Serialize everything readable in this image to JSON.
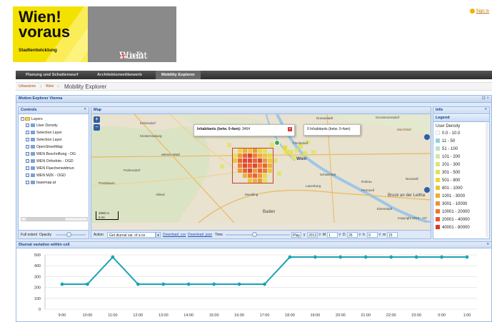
{
  "header": {
    "logo_title": "Wien! voraus",
    "logo_subtitle": "Stadtentwicklung",
    "city_logo": "StaDt",
    "city_logo_cross": "+",
    "city_logo_end": "Wien",
    "signout_label": "Sign in"
  },
  "nav": {
    "tabs": [
      {
        "label": "Planung und Schattenwurf"
      },
      {
        "label": "Architekturwettbewerb"
      },
      {
        "label": "Mobility Explorer"
      }
    ]
  },
  "breadcrumb": {
    "items": [
      "Urbanizmo",
      "Wien"
    ],
    "current": "Mobility Explorer"
  },
  "app": {
    "title": "Motion Explorer Vienna",
    "controls": {
      "title": "Controls",
      "layers_root": "Layers",
      "layers": [
        "User Density",
        "Selection Layer",
        "Selection Layer",
        "OpenStreetMap",
        "WEN Beschriftung - OG",
        "WEN Orthofoto - OGD",
        "WEN Flaechenwidmun",
        "WEN MZK - OGD",
        "basemap.at"
      ],
      "full_extent": "Full extent",
      "opacity": "Opacity"
    },
    "map": {
      "title": "Map",
      "popup1_label": "Inhabitants (betw. 0-4am):",
      "popup1_value": "3464",
      "popup2_text": "0 Inhabitants (betw. 0-4am)",
      "scale_1": "2000 m",
      "scale_2": "5 mi",
      "copyright": "Copyright 2013 - AIT",
      "labels": [
        "Donaustadt",
        "Grossenzersdorf",
        "Marchfeld",
        "Kritzendorf",
        "Klosterneuburg",
        "Floridsdorf",
        "Wiener Wald",
        "Purkersdorf",
        "Wien",
        "Schwechat",
        "Laxenburg",
        "Bruck an der Leitha",
        "Baden",
        "Moedling",
        "Eisenstadt",
        "Neusiedl",
        "Rohrau",
        "Petronell",
        "Alland",
        "Pressbaum"
      ],
      "action_label": "Action",
      "action_value": "Get diurnal var. of a ce",
      "download_csv": "Download .csv",
      "download_json": "Download .json",
      "time_label": "Time",
      "play_label": "Play",
      "y_label": "y",
      "year": "2013",
      "m_label": "M",
      "month": "1",
      "d_label": "D",
      "day": "26",
      "h_label": "h",
      "hour": "9",
      "min_label": "m",
      "minute": "15"
    },
    "info": {
      "title": "Info",
      "legend_title": "Legend",
      "legend_heading": "User Density",
      "legend": [
        {
          "label": "0.0 - 10.0",
          "color": "#ffffff"
        },
        {
          "label": "11 - 50",
          "color": "#8fd3e0"
        },
        {
          "label": "51 - 100",
          "color": "#b7e2c9"
        },
        {
          "label": "101 - 200",
          "color": "#d4e79a"
        },
        {
          "label": "201 - 300",
          "color": "#dfe46e"
        },
        {
          "label": "301 - 500",
          "color": "#e6e14a"
        },
        {
          "label": "501 - 800",
          "color": "#e9d832"
        },
        {
          "label": "801 - 1000",
          "color": "#edc52c"
        },
        {
          "label": "1001 - 3000",
          "color": "#efac2a"
        },
        {
          "label": "3001 - 10000",
          "color": "#f09128"
        },
        {
          "label": "10001 - 20000",
          "color": "#f07426"
        },
        {
          "label": "20001 - 40000",
          "color": "#ec5524"
        },
        {
          "label": "40001 - 80000",
          "color": "#e43522"
        }
      ]
    },
    "chart_panel_title": "Diurnal variation within cell"
  },
  "chart_data": {
    "type": "line",
    "title": "Diurnal variation within cell",
    "categories": [
      "9:00",
      "10:00",
      "11:00",
      "12:00",
      "13:00",
      "14:00",
      "15:00",
      "16:00",
      "17:00",
      "18:00",
      "19:00",
      "20:00",
      "21:00",
      "22:00",
      "23:00",
      "0:00",
      "1:00"
    ],
    "values": [
      230,
      230,
      480,
      230,
      230,
      230,
      230,
      230,
      230,
      480,
      480,
      480,
      480,
      480,
      480,
      480,
      480
    ],
    "ylim": [
      0,
      500
    ],
    "yticks": [
      0,
      100,
      200,
      300,
      400,
      500
    ],
    "color": "#1ba3b6",
    "grid": true
  }
}
